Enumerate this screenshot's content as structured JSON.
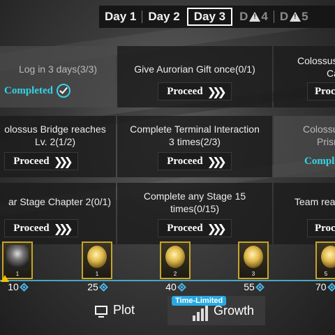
{
  "days": [
    {
      "label": "Day 1",
      "state": "normal"
    },
    {
      "label": "Day 2",
      "state": "normal"
    },
    {
      "label": "Day 3",
      "state": "active"
    },
    {
      "label": "D",
      "suffix": "4",
      "state": "locked"
    },
    {
      "label": "D",
      "suffix": "5",
      "state": "locked"
    }
  ],
  "tasks": {
    "r1c1": {
      "text": "Log in 3 days(3/3)",
      "status": "Completed"
    },
    "r1c2": {
      "text": "Give Aurorian Gift once(0/1)",
      "button": "Proceed"
    },
    "r1c3": {
      "text": "Colossus",
      "text2": "Ca",
      "button": "Proce"
    },
    "r2c1": {
      "text": "olossus Bridge reaches Lv. 2(1/2)",
      "button": "Proceed"
    },
    "r2c2": {
      "text": "Complete Terminal Interaction 3 times(2/3)",
      "button": "Proceed"
    },
    "r2c3": {
      "text": "Colossu",
      "text2": "Prism",
      "status": "Compl"
    },
    "r3c1": {
      "text": "ar Stage Chapter 2(0/1)",
      "button": "Proceed"
    },
    "r3c2": {
      "text": "Complete any Stage 15 times(0/15)",
      "button": "Proceed"
    },
    "r3c3": {
      "text": "Team reac",
      "button": "Proce"
    }
  },
  "rewards": [
    {
      "count": "1",
      "milestone": "10"
    },
    {
      "count": "1",
      "milestone": "25"
    },
    {
      "count": "2",
      "milestone": "40"
    },
    {
      "count": "3",
      "milestone": "55"
    },
    {
      "count": "5",
      "milestone": "70"
    }
  ],
  "nav": {
    "plot": "Plot",
    "growth": "Growth",
    "badge": "Time-Limited"
  },
  "colors": {
    "accent": "#34d4e6",
    "reward_border": "#c7a52a",
    "badge": "#29a9e1"
  },
  "icons": [
    "check-icon",
    "chevron-right-icon",
    "warning-icon",
    "diamond-icon",
    "monitor-icon",
    "bar-chart-icon"
  ]
}
